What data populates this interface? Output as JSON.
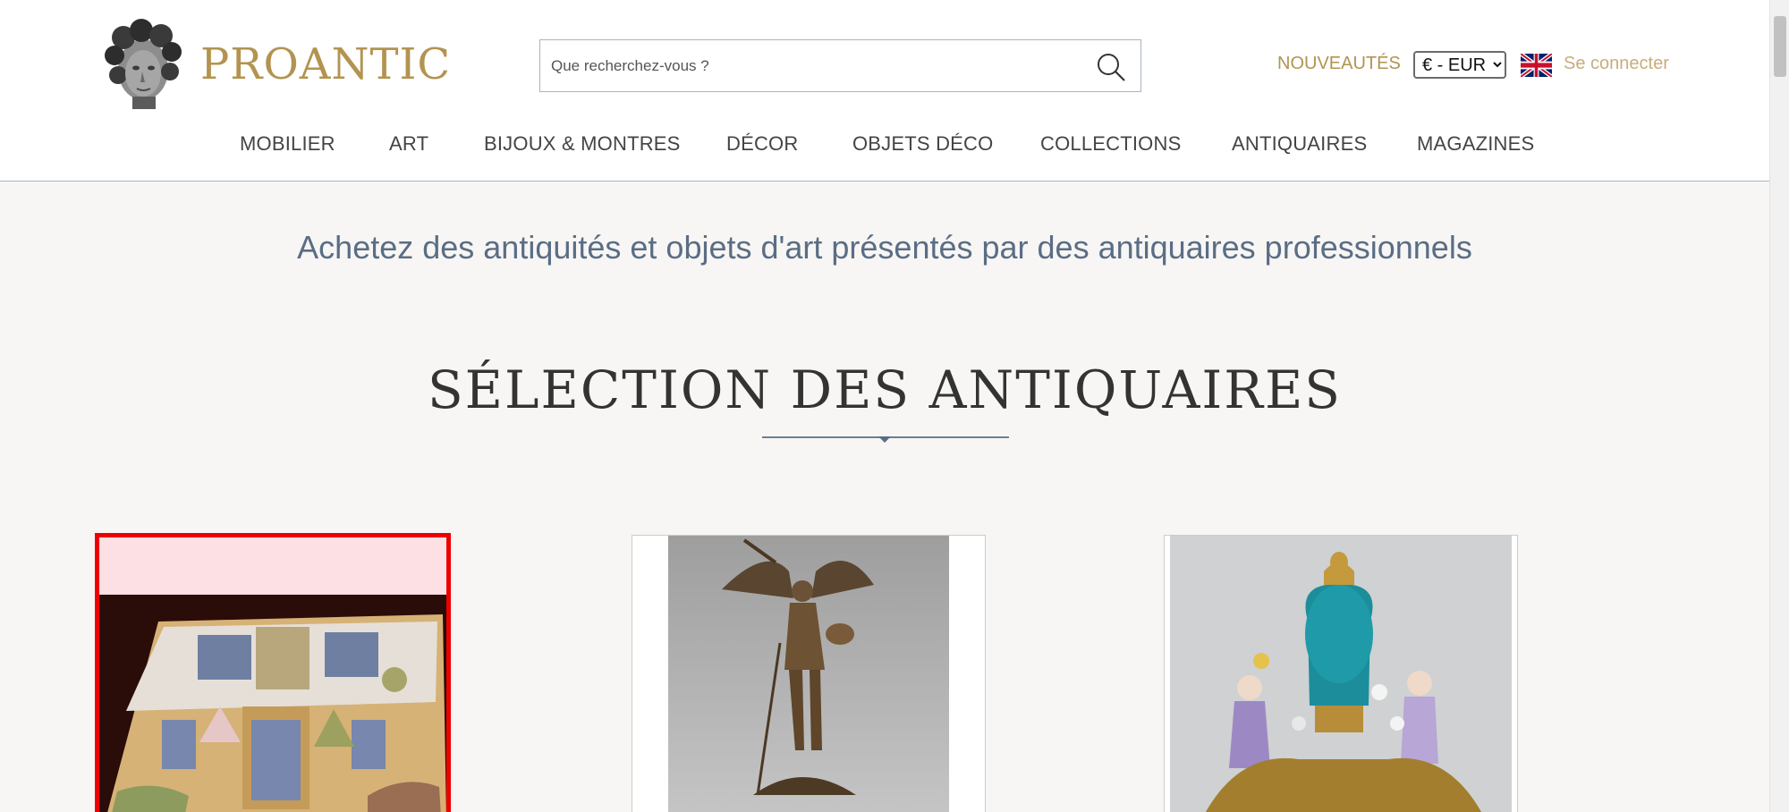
{
  "header": {
    "logo_text": "PROANTIC",
    "search_placeholder": "Que recherchez-vous ?",
    "nouveautes_label": "NOUVEAUTÉS",
    "currency_selected": "€ - EUR",
    "login_label": "Se connecter",
    "flag_icon": "uk-flag-icon"
  },
  "nav": {
    "items": [
      {
        "label": "MOBILIER"
      },
      {
        "label": "ART"
      },
      {
        "label": "BIJOUX & MONTRES"
      },
      {
        "label": "DÉCOR"
      },
      {
        "label": "OBJETS DÉCO"
      },
      {
        "label": "COLLECTIONS"
      },
      {
        "label": "ANTIQUAIRES"
      },
      {
        "label": "MAGAZINES"
      }
    ]
  },
  "main": {
    "tagline": "Achetez des antiquités et objets d'art présentés par des antiquaires professionnels",
    "section_title": "SÉLECTION DES ANTIQUAIRES"
  },
  "colors": {
    "brand_gold": "#b39350",
    "tagline_blue": "#5a6d85",
    "highlight_red": "#ee0000"
  }
}
